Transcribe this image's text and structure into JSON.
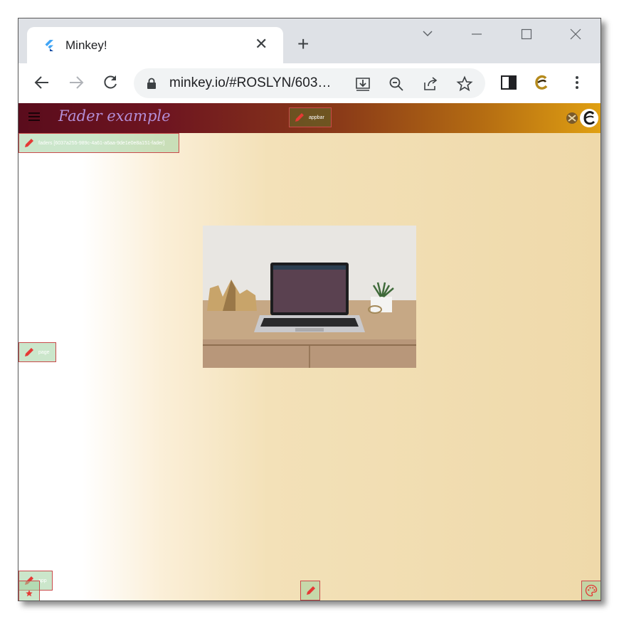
{
  "browser": {
    "tab": {
      "title": "Minkey!",
      "close_glyph": "✕",
      "favicon": "flutter-logo-icon"
    },
    "new_tab_glyph": "+",
    "url": "minkey.io/#ROSLYN/603…",
    "window_controls": [
      "minimize-icon",
      "maximize-icon",
      "close-icon"
    ]
  },
  "app": {
    "title": "Fader example",
    "colors": {
      "appbar_start": "#5a0c1c",
      "appbar_end": "#e0a012",
      "page_fade": "#efd9aa",
      "edit_border": "#c94b4b"
    },
    "edit_labels": {
      "faders": "faders [6037a255-989c-4a61-a6aa-9de1e0e8a151-fader]",
      "appbar": "appbar",
      "page": "page",
      "app": "app"
    }
  }
}
